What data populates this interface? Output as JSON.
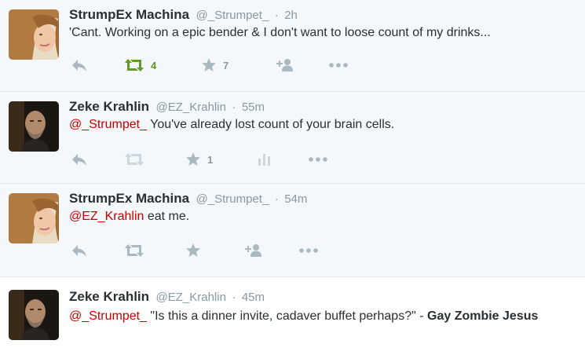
{
  "tweets": [
    {
      "fullname": "StrumpEx Machina",
      "username": "@_Strumpet_",
      "time": "2h",
      "segments": [
        {
          "type": "text",
          "value": "'Cant.  Working on a epic bender & I don't want to loose count of my drinks..."
        }
      ],
      "actions": {
        "retweet_count": "4",
        "favorite_count": "7",
        "retweeted": true,
        "has_follow": true,
        "has_stats": false
      }
    },
    {
      "fullname": "Zeke Krahlin",
      "username": "@EZ_Krahlin",
      "time": "55m",
      "segments": [
        {
          "type": "mention",
          "value": "@_Strumpet_"
        },
        {
          "type": "text",
          "value": " You've already lost count of your brain cells."
        }
      ],
      "actions": {
        "retweet_count": "",
        "favorite_count": "1",
        "retweeted": false,
        "has_follow": false,
        "has_stats": true
      }
    },
    {
      "fullname": "StrumpEx Machina",
      "username": "@_Strumpet_",
      "time": "54m",
      "segments": [
        {
          "type": "mention",
          "value": "@EZ_Krahlin"
        },
        {
          "type": "text",
          "value": " eat me."
        }
      ],
      "actions": {
        "retweet_count": "",
        "favorite_count": "",
        "retweeted": false,
        "has_follow": true,
        "has_stats": false
      }
    },
    {
      "fullname": "Zeke Krahlin",
      "username": "@EZ_Krahlin",
      "time": "45m",
      "segments": [
        {
          "type": "mention",
          "value": "@_Strumpet_"
        },
        {
          "type": "text",
          "value": " \"Is this a dinner invite, cadaver buffet perhaps?\" - "
        },
        {
          "type": "bold",
          "value": "Gay Zombie Jesus"
        }
      ],
      "actions": null
    }
  ],
  "separator": "·",
  "colors": {
    "mention": "#cc0000",
    "retweet_active": "#609928",
    "muted": "#8899a6",
    "bg_gray": "#f5f8fa"
  }
}
